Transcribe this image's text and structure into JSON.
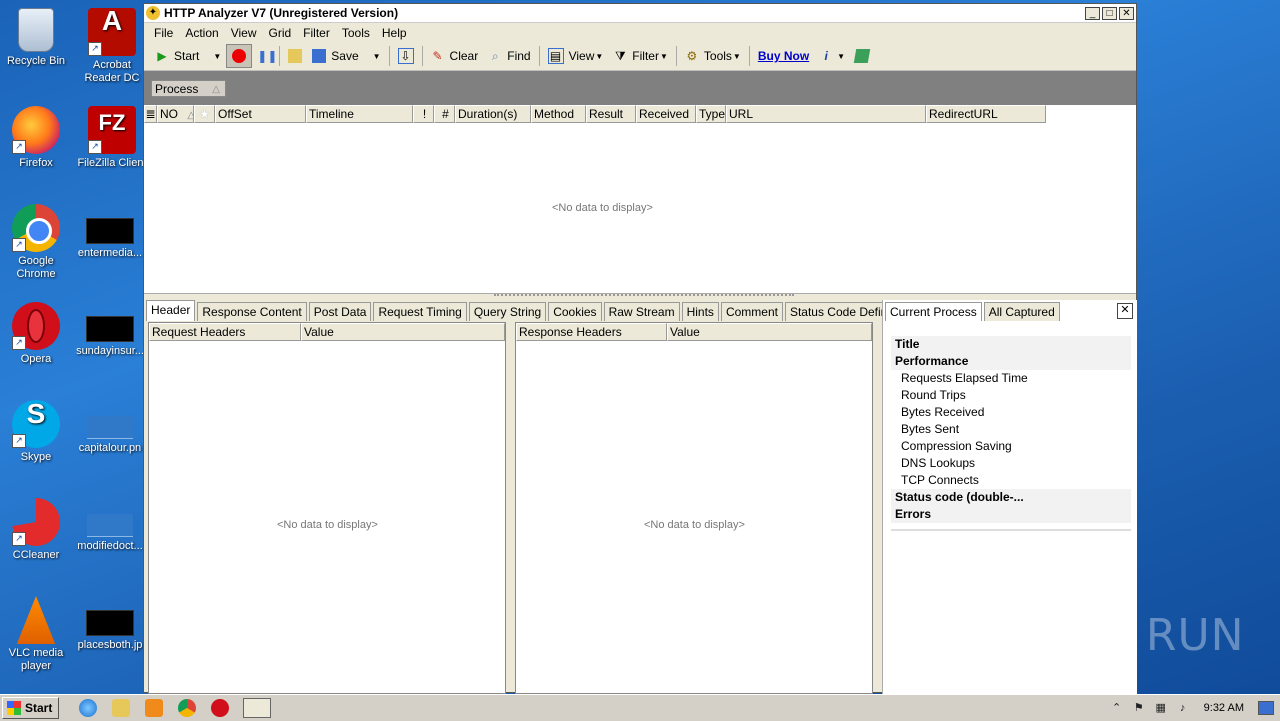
{
  "desktop": {
    "icons": [
      {
        "label": "Recycle Bin"
      },
      {
        "label": "Acrobat Reader DC"
      },
      {
        "label": "Firefox"
      },
      {
        "label": "FileZilla Client"
      },
      {
        "label": "Google Chrome"
      },
      {
        "label": "entermedia..."
      },
      {
        "label": "Opera"
      },
      {
        "label": "sundayinsur..."
      },
      {
        "label": "Skype"
      },
      {
        "label": "capitalour.pn"
      },
      {
        "label": "CCleaner"
      },
      {
        "label": "modifiedoct..."
      },
      {
        "label": "VLC media player"
      },
      {
        "label": "placesboth.jp"
      }
    ]
  },
  "window": {
    "title": "HTTP Analyzer V7  (Unregistered Version)",
    "controls": {
      "minimize": "_",
      "maximize": "□",
      "close": "✕"
    },
    "menu": [
      "File",
      "Action",
      "View",
      "Grid",
      "Filter",
      "Tools",
      "Help"
    ],
    "toolbar": {
      "start": "Start",
      "save": "Save",
      "clear": "Clear",
      "find": "Find",
      "view": "View",
      "filter": "Filter",
      "tools": "Tools",
      "buy_now": "Buy Now",
      "info": "i"
    },
    "group_chip": "Process",
    "grid": {
      "columns": [
        "NO",
        "",
        "OffSet",
        "Timeline",
        "!",
        "#",
        "Duration(s)",
        "Method",
        "Result",
        "Received",
        "Type",
        "URL",
        "RedirectURL"
      ],
      "empty": "<No data to display>"
    },
    "detail_tabs": [
      "Header",
      "Response Content",
      "Post Data",
      "Request Timing",
      "Query String",
      "Cookies",
      "Raw Stream",
      "Hints",
      "Comment",
      "Status Code Definition"
    ],
    "request_pane": {
      "col1": "Request Headers",
      "col2": "Value",
      "empty": "<No data to display>"
    },
    "response_pane": {
      "col1": "Response Headers",
      "col2": "Value",
      "empty": "<No data to display>"
    },
    "right_tabs": [
      "Current Process",
      "All Captured"
    ],
    "right_close": "✕",
    "properties": [
      {
        "label": "Title",
        "kind": "head"
      },
      {
        "label": "Performance",
        "kind": "head"
      },
      {
        "label": "Requests Elapsed Time",
        "kind": "sub"
      },
      {
        "label": "Round Trips",
        "kind": "sub"
      },
      {
        "label": "Bytes Received",
        "kind": "sub"
      },
      {
        "label": "Bytes Sent",
        "kind": "sub"
      },
      {
        "label": "Compression Saving",
        "kind": "sub"
      },
      {
        "label": "DNS Lookups",
        "kind": "sub"
      },
      {
        "label": "TCP Connects",
        "kind": "sub"
      },
      {
        "label": "Status code (double-...",
        "kind": "head"
      },
      {
        "label": "Errors",
        "kind": "head"
      }
    ]
  },
  "taskbar": {
    "start": "Start",
    "clock": "9:32 AM"
  },
  "watermark": "ANY RUN"
}
